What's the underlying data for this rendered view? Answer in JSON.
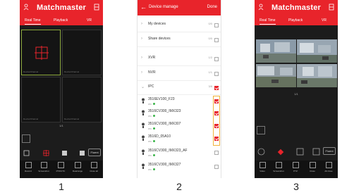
{
  "app": {
    "title": "Matchmaster"
  },
  "live_tabs": [
    "Real Time",
    "Playback",
    "VR"
  ],
  "grid_labels": [
    "Device/Channel",
    "Device/Channel",
    "Device/Channel",
    "Device/Channel"
  ],
  "pager": "1/1",
  "fluent_label": "Fluent",
  "toolbar": [
    "Record",
    "Screenshot",
    "PTZ/UTC",
    "Rearrange",
    "Close all"
  ],
  "toolbar3": [
    "Video",
    "Screenshot",
    "PTZ",
    "Close",
    "All close"
  ],
  "device_manage": {
    "title": "Device manage",
    "done": "Done",
    "groups": [
      {
        "label": "My devices",
        "count": "0/0"
      },
      {
        "label": "Share devices",
        "count": "0/0"
      },
      {
        "label": "XVR",
        "count": "1/2"
      },
      {
        "label": "NVR",
        "count": "1/1"
      },
      {
        "label": "IPC",
        "count": "3/8"
      }
    ],
    "ipc_devices": [
      {
        "name": "3516EV100_F23",
        "type": "IPC",
        "checked": true
      },
      {
        "name": "3516CV300_IMX323",
        "type": "IPC",
        "checked": true
      },
      {
        "name": "3516CV300_IMX307",
        "type": "IPC",
        "checked": true
      },
      {
        "name": "3516D_05A10",
        "type": "IPC",
        "checked": true
      },
      {
        "name": "3516CV300_IMX323_AF",
        "type": "IPC",
        "checked": false
      },
      {
        "name": "3516CV300_IMX327",
        "type": "IPC",
        "checked": false
      }
    ]
  },
  "captions": [
    "1",
    "2",
    "3"
  ],
  "colors": {
    "accent": "#e8242b",
    "highlight": "#f2b33a",
    "online": "#3bb54a"
  }
}
